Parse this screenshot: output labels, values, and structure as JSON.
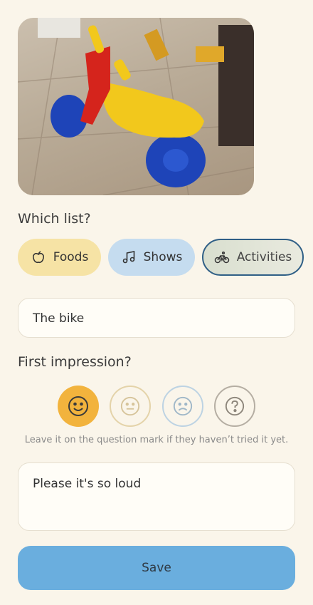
{
  "photo": {
    "alt": "Child's ride-on tricycle toy"
  },
  "list_question": "Which list?",
  "lists": [
    {
      "label": "Foods",
      "icon": "apple-icon",
      "bg": "#f6e3a5",
      "selected": false
    },
    {
      "label": "Shows",
      "icon": "music-note-icon",
      "bg": "#c5dcef",
      "selected": false
    },
    {
      "label": "Activities",
      "icon": "bike-icon",
      "bg": "#d9dfcf",
      "selected": true
    }
  ],
  "name_field": {
    "value": "The bike"
  },
  "impression_question": "First impression?",
  "impressions": [
    {
      "name": "happy-face-icon",
      "selected": true
    },
    {
      "name": "neutral-face-icon",
      "selected": false
    },
    {
      "name": "sad-face-icon",
      "selected": false
    },
    {
      "name": "question-mark-icon",
      "selected": false
    }
  ],
  "impression_hint": "Leave it on the question mark if they haven’t tried it yet.",
  "notes_field": {
    "value": "Please it's so loud"
  },
  "save_label": "Save",
  "colors": {
    "accent": "#6aaede",
    "selected_face": "#f2b33d",
    "background": "#faf5ea"
  }
}
